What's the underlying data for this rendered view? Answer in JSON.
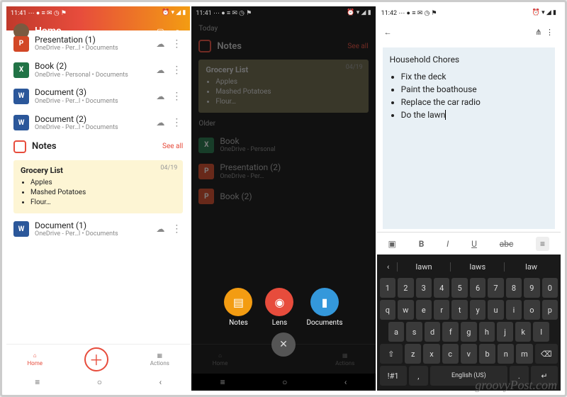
{
  "status": {
    "time1": "11:41",
    "time2": "11:41",
    "time3": "11:42",
    "tray": "⋯ ● ≡ ✉ ◷ ⚑",
    "right": "⏰ ▾ ◢ ▮"
  },
  "screen1": {
    "home": "Home",
    "files": [
      {
        "icon": "pp",
        "glyph": "P",
        "name": "Presentation (1)",
        "sub": "OneDrive - Per…l • Documents"
      },
      {
        "icon": "xl",
        "glyph": "X",
        "name": "Book (2)",
        "sub": "OneDrive - Personal • Documents"
      },
      {
        "icon": "wd",
        "glyph": "W",
        "name": "Document (3)",
        "sub": "OneDrive - Per…l • Documents"
      },
      {
        "icon": "wd",
        "glyph": "W",
        "name": "Document (2)",
        "sub": "OneDrive - Per…l • Documents"
      }
    ],
    "notes_title": "Notes",
    "seeall": "See all",
    "card": {
      "title": "Grocery List",
      "date": "04/19",
      "items": [
        "Apples",
        "Mashed Potatoes",
        "Flour…"
      ]
    },
    "file_last": {
      "icon": "wd",
      "glyph": "W",
      "name": "Document (1)",
      "sub": "OneDrive - Per…l • Documents"
    },
    "nav": {
      "home": "Home",
      "actions": "Actions"
    }
  },
  "screen2": {
    "today": "Today",
    "notes": "Notes",
    "seeall": "See all",
    "card": {
      "title": "Grocery List",
      "date": "04/19",
      "items": [
        "Apples",
        "Mashed Potatoes",
        "Flour…"
      ]
    },
    "older": "Older",
    "olderfiles": [
      {
        "name": "Book",
        "sub": "OneDrive - Personal"
      },
      {
        "name": "Presentation (2)",
        "sub": "OneDrive - Per…"
      },
      {
        "name": "Book (2)",
        "sub": ""
      }
    ],
    "fab": {
      "notes": "Notes",
      "lens": "Lens",
      "docs": "Documents"
    }
  },
  "screen3": {
    "title": "Household Chores",
    "items": [
      "Fix the deck",
      "Paint the boathouse",
      "Replace the car radio",
      "Do the lawn"
    ],
    "suggest": [
      "lawn",
      "laws",
      "law"
    ],
    "space": "English (US)"
  },
  "watermark": "groovyPost.com"
}
